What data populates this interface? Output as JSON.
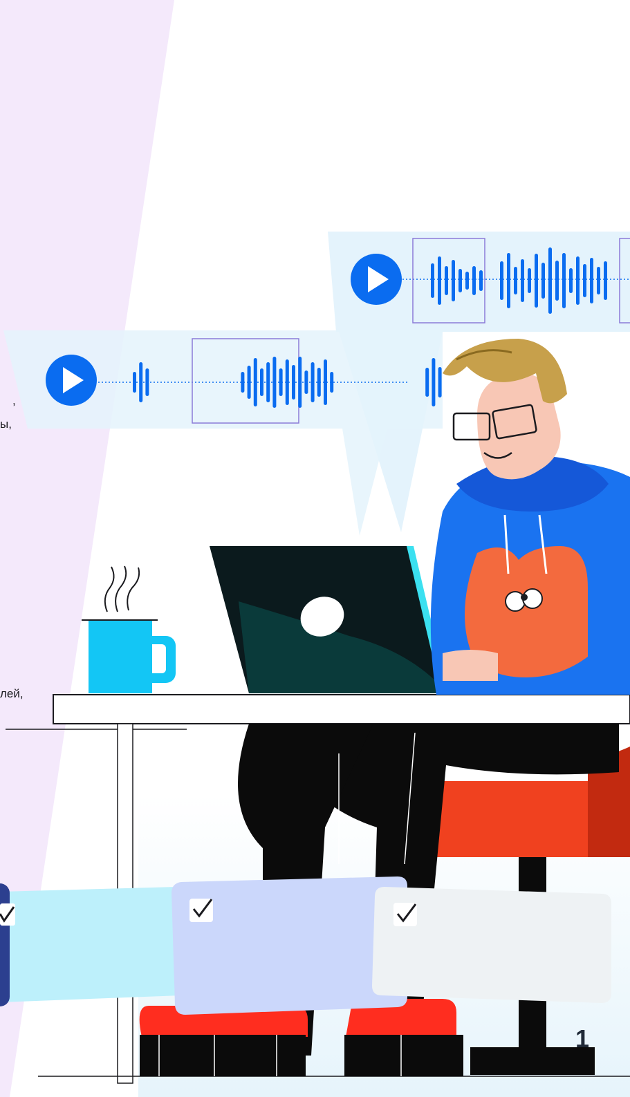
{
  "page_number": "1",
  "text_fragments": [
    ",",
    "ы,",
    "лей,"
  ],
  "colors": {
    "lavender_panel": "#f4e9fb",
    "bubble": "#e4f3fc",
    "waveform_blue": "#0a6cf0",
    "selection_frame": "#8b7bd8",
    "card_cyan": "#bdf0fb",
    "card_periwinkle": "#cbd7fb",
    "card_gray": "#eef2f4",
    "hoodie_blue": "#1a73f0",
    "chair_red": "#f0411f",
    "mug_cyan": "#13c6f5"
  },
  "icons": {
    "voice_message_top": "play-icon",
    "voice_message_left": "play-icon",
    "checkbox": "check-icon"
  }
}
